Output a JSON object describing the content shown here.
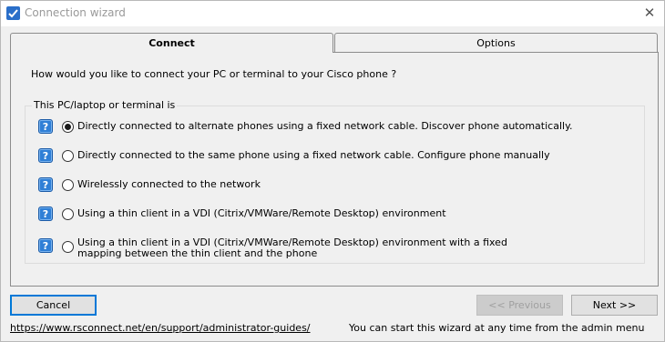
{
  "window": {
    "title": "Connection wizard",
    "close_glyph": "✕",
    "icon": "app-icon"
  },
  "tabs": [
    {
      "label": "Connect",
      "active": true
    },
    {
      "label": "Options",
      "active": false
    }
  ],
  "connect": {
    "question": "How would you like to connect your PC or terminal to your Cisco phone ?",
    "group_label": "This PC/laptop or terminal is",
    "help_glyph": "?",
    "options": [
      {
        "label": "Directly connected to alternate phones using a fixed network cable. Discover phone automatically.",
        "selected": true
      },
      {
        "label": "Directly connected to the same phone using a fixed network cable. Configure phone manually",
        "selected": false
      },
      {
        "label": "Wirelessly connected to the network",
        "selected": false
      },
      {
        "label": "Using a thin client in a VDI (Citrix/VMWare/Remote Desktop) environment",
        "selected": false
      },
      {
        "label": "Using a thin client in a VDI (Citrix/VMWare/Remote Desktop) environment with a fixed",
        "label_line2": "mapping between the thin client and the phone",
        "selected": false
      }
    ]
  },
  "buttons": {
    "cancel": "Cancel",
    "previous": "<< Previous",
    "next": "Next >>"
  },
  "footer": {
    "link": "https://www.rsconnect.net/en/support/administrator-guides/",
    "hint": "You can start this wizard at any time from the admin menu"
  },
  "colors": {
    "accent": "#0078d7",
    "help_icon": "#2f7fd6",
    "background": "#f0f0f0"
  }
}
